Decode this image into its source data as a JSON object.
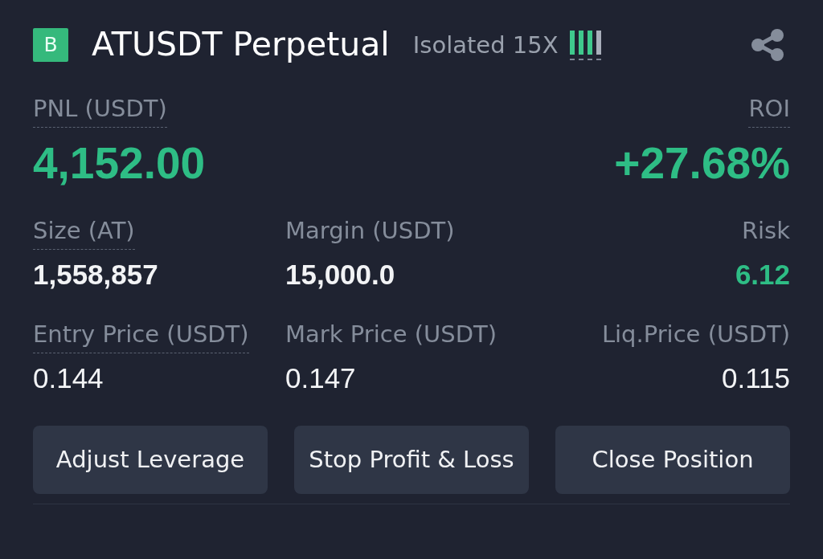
{
  "header": {
    "logo": "B",
    "title": "ATUSDT Perpetual",
    "margin_mode": "Isolated 15X",
    "leverage_meter": [
      {
        "lit": true
      },
      {
        "lit": true
      },
      {
        "lit": true
      },
      {
        "lit": false
      }
    ]
  },
  "summary": [
    {
      "label": "PNL (USDT)",
      "dotted": true,
      "value": "4,152.00",
      "positive": true
    },
    {
      "label": "ROI",
      "dotted": true,
      "value": "+27.68%",
      "positive": true
    }
  ],
  "details": [
    [
      {
        "label": "Size (AT)",
        "dotted": true,
        "value": "1,558,857",
        "positive": false,
        "bold": true
      },
      {
        "label": "Margin (USDT)",
        "dotted": false,
        "value": "15,000.0",
        "positive": false,
        "bold": true
      },
      {
        "label": "Risk",
        "dotted": false,
        "value": "6.12",
        "positive": true,
        "bold": true
      }
    ],
    [
      {
        "label": "Entry Price (USDT)",
        "dotted": true,
        "value": "0.144",
        "positive": false,
        "bold": false
      },
      {
        "label": "Mark Price (USDT)",
        "dotted": false,
        "value": "0.147",
        "positive": false,
        "bold": false
      },
      {
        "label": "Liq.Price (USDT)",
        "dotted": false,
        "value": "0.115",
        "positive": false,
        "bold": false
      }
    ]
  ],
  "buttons": [
    "Adjust Leverage",
    "Stop Profit & Loss",
    "Close Position"
  ]
}
